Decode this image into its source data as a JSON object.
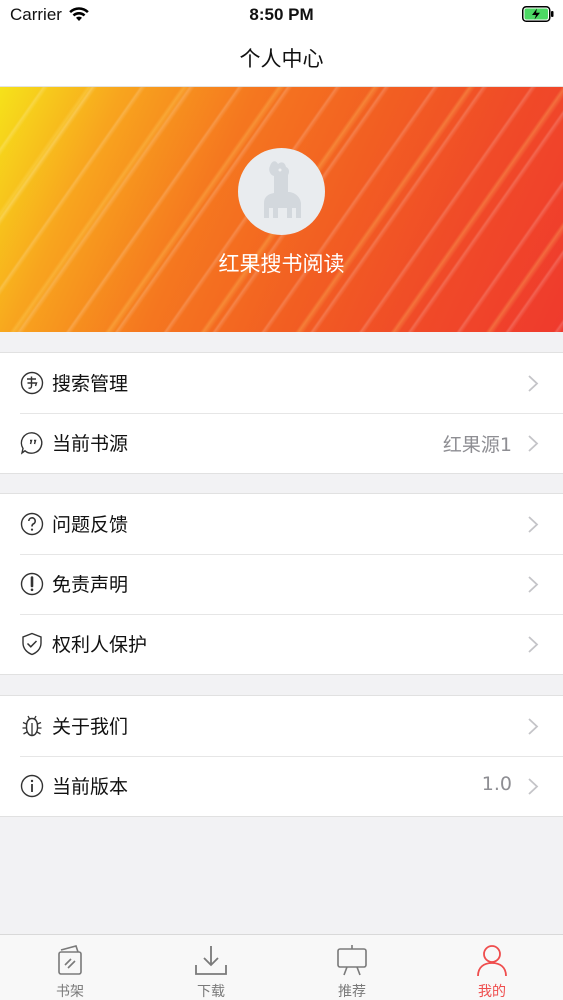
{
  "status_bar": {
    "carrier": "Carrier",
    "time": "8:50 PM"
  },
  "nav": {
    "title": "个人中心"
  },
  "banner": {
    "name": "红果搜书阅读"
  },
  "groups": [
    [
      {
        "label": "搜索管理",
        "value": "",
        "icon": "book-circle-icon"
      },
      {
        "label": "当前书源",
        "value": "红果源1",
        "icon": "chat-bubble-icon"
      }
    ],
    [
      {
        "label": "问题反馈",
        "value": "",
        "icon": "question-circle-icon"
      },
      {
        "label": "免责声明",
        "value": "",
        "icon": "exclamation-circle-icon"
      },
      {
        "label": "权利人保护",
        "value": "",
        "icon": "shield-check-icon"
      }
    ],
    [
      {
        "label": "关于我们",
        "value": "",
        "icon": "bug-icon"
      },
      {
        "label": "当前版本",
        "value": "1.0",
        "icon": "info-circle-icon"
      }
    ]
  ],
  "tabs": [
    {
      "label": "书架",
      "icon": "bookshelf-icon",
      "active": false
    },
    {
      "label": "下载",
      "icon": "download-icon",
      "active": false
    },
    {
      "label": "推荐",
      "icon": "easel-icon",
      "active": false
    },
    {
      "label": "我的",
      "icon": "person-icon",
      "active": true
    }
  ],
  "colors": {
    "accent": "#ef4d4d",
    "secondary_text": "#8e8e93",
    "battery": "#4cd964"
  }
}
